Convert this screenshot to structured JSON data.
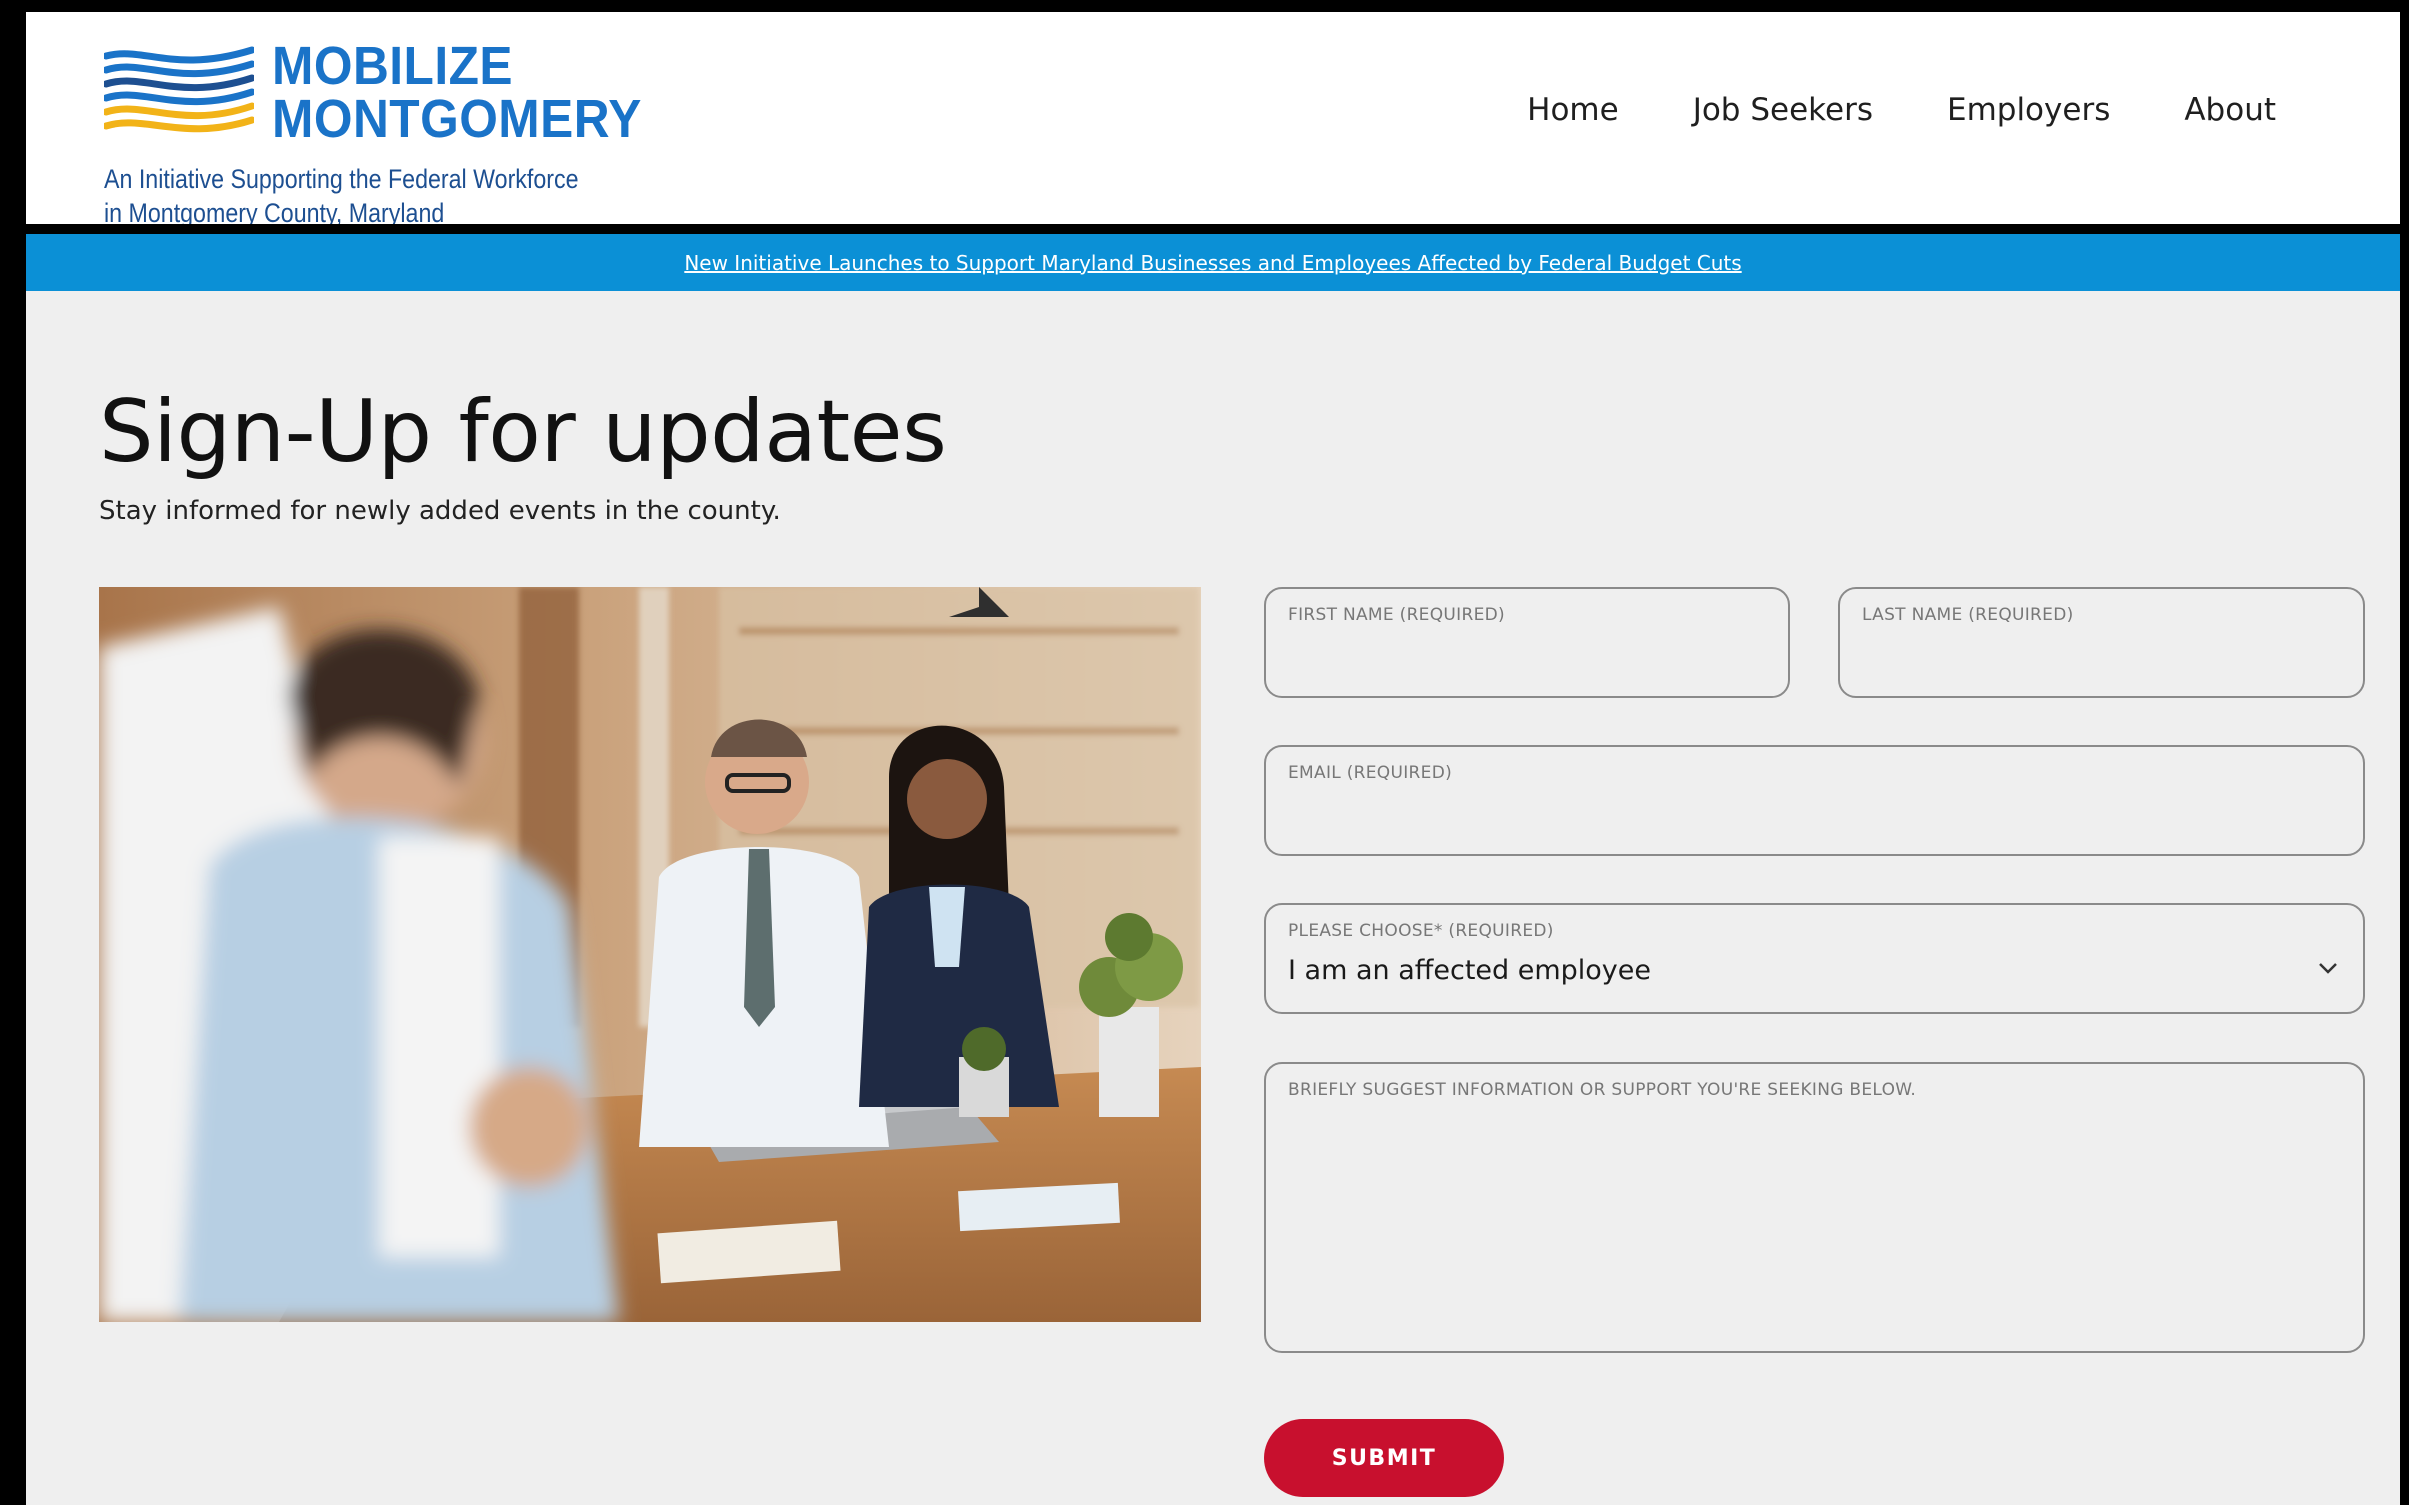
{
  "brand": {
    "title_line1": "MOBILIZE",
    "title_line2": "MONTGOMERY",
    "tagline_line1": "An Initiative Supporting the Federal Workforce",
    "tagline_line2": "in Montgomery County, Maryland",
    "colors": {
      "blue": "#1a73c8",
      "navy": "#1d4f91",
      "gold": "#f2b318"
    }
  },
  "nav": {
    "items": [
      {
        "label": "Home"
      },
      {
        "label": "Job Seekers"
      },
      {
        "label": "Employers"
      },
      {
        "label": "About"
      }
    ]
  },
  "announcement": {
    "text": "New Initiative Launches to Support Maryland Businesses and Employees Affected by Federal Budget Cuts",
    "color": "#0b90d6"
  },
  "page": {
    "title": "Sign-Up for updates",
    "subtitle": "Stay informed for newly added events in the county."
  },
  "form": {
    "first_name": {
      "label": "FIRST NAME (REQUIRED)",
      "value": ""
    },
    "last_name": {
      "label": "LAST NAME (REQUIRED)",
      "value": ""
    },
    "email": {
      "label": "EMAIL (REQUIRED)",
      "value": ""
    },
    "choice": {
      "label": "PLEASE CHOOSE* (REQUIRED)",
      "value": "I am an affected employee"
    },
    "message": {
      "label": "BRIEFLY SUGGEST INFORMATION OR SUPPORT YOU'RE SEEKING BELOW.",
      "value": ""
    },
    "submit_label": "SUBMIT",
    "submit_color": "#c8102e"
  },
  "icons": {
    "logo": "waves-logo-icon",
    "select": "chevron-down-icon"
  }
}
